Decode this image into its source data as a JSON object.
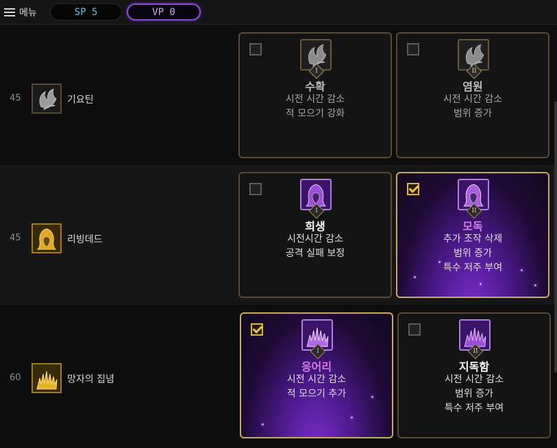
{
  "topbar": {
    "menu_label": "메뉴",
    "sp_label": "SP 5",
    "vp_label": "VP 0"
  },
  "rows": [
    {
      "level": "45",
      "skill_name": "기요틴",
      "icon": "flame-claw-icon",
      "options": [
        {
          "rank": "I",
          "title": "수확",
          "lines": [
            "시전 시간 감소",
            "적 모으기 강화"
          ],
          "checked": false,
          "selected": false
        },
        {
          "rank": "II",
          "title": "염원",
          "lines": [
            "시전 시간 감소",
            "범위 증가"
          ],
          "checked": false,
          "selected": false
        }
      ]
    },
    {
      "level": "45",
      "skill_name": "리빙데드",
      "icon": "hooded-figure-icon",
      "options": [
        {
          "rank": "I",
          "title": "희생",
          "lines": [
            "시전시간 감소",
            "공격 실패 보정"
          ],
          "checked": false,
          "selected": false
        },
        {
          "rank": "II",
          "title": "모독",
          "lines": [
            "추가 조작 삭제",
            "범위 증가",
            "특수 저주 부여"
          ],
          "checked": true,
          "selected": true
        }
      ]
    },
    {
      "level": "60",
      "skill_name": "망자의 집념",
      "icon": "grasping-hands-icon",
      "options": [
        {
          "rank": "I",
          "title": "응어리",
          "lines": [
            "시전 시간 감소",
            "적 모으기 추가"
          ],
          "checked": true,
          "selected": true
        },
        {
          "rank": "II",
          "title": "지독함",
          "lines": [
            "시전 시간 감소",
            "범위 증가",
            "특수 저주 부여"
          ],
          "checked": false,
          "selected": false
        }
      ]
    }
  ]
}
